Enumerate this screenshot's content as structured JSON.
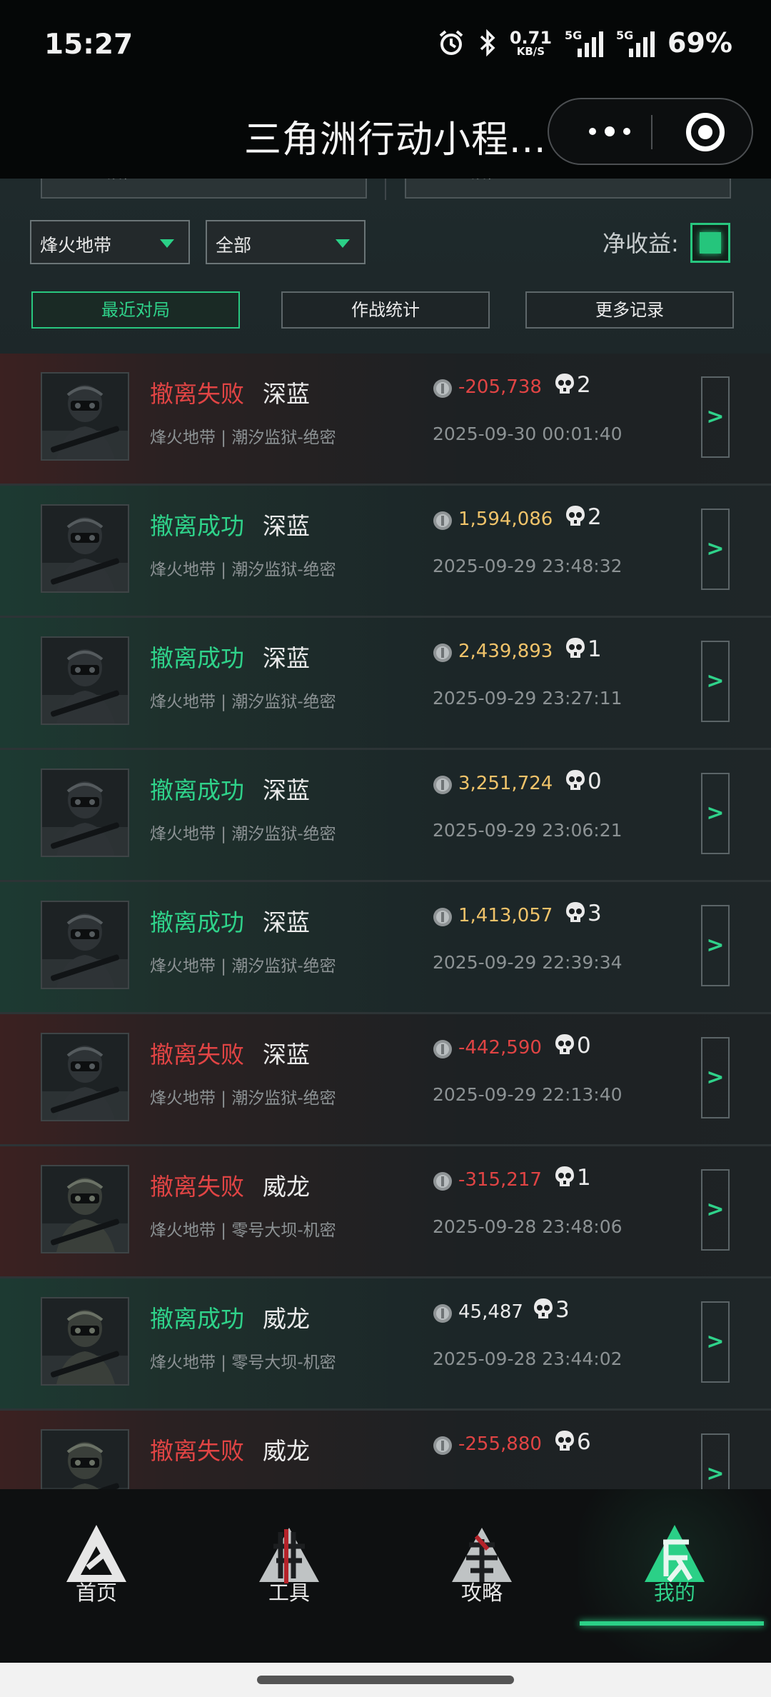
{
  "status_bar": {
    "time": "15:27",
    "net_speed_value": "0.71",
    "net_speed_unit": "KB/S",
    "network1": "5G",
    "network2": "5G",
    "battery": "69%"
  },
  "title_bar": {
    "title": "三角洲行动小程..."
  },
  "top_cards": {
    "left_label": "段位",
    "right_label": "段位"
  },
  "filters": {
    "mode": "烽火地带",
    "scope": "全部",
    "net_income_label": "净收益:"
  },
  "tabs": [
    {
      "label": "最近对局",
      "active": true
    },
    {
      "label": "作战统计",
      "active": false
    },
    {
      "label": "更多记录",
      "active": false
    }
  ],
  "matches": [
    {
      "result": "撤离失败",
      "status": "fail",
      "operator": "深蓝",
      "map": "烽火地带 | 潮汐监狱-绝密",
      "net": "-205,738",
      "sign": "neg",
      "kills": "2",
      "time": "2025-09-30 00:01:40",
      "avatar": "operator-a"
    },
    {
      "result": "撤离成功",
      "status": "success",
      "operator": "深蓝",
      "map": "烽火地带 | 潮汐监狱-绝密",
      "net": "1,594,086",
      "sign": "pos",
      "kills": "2",
      "time": "2025-09-29 23:48:32",
      "avatar": "operator-a"
    },
    {
      "result": "撤离成功",
      "status": "success",
      "operator": "深蓝",
      "map": "烽火地带 | 潮汐监狱-绝密",
      "net": "2,439,893",
      "sign": "pos",
      "kills": "1",
      "time": "2025-09-29 23:27:11",
      "avatar": "operator-a"
    },
    {
      "result": "撤离成功",
      "status": "success",
      "operator": "深蓝",
      "map": "烽火地带 | 潮汐监狱-绝密",
      "net": "3,251,724",
      "sign": "pos",
      "kills": "0",
      "time": "2025-09-29 23:06:21",
      "avatar": "operator-a"
    },
    {
      "result": "撤离成功",
      "status": "success",
      "operator": "深蓝",
      "map": "烽火地带 | 潮汐监狱-绝密",
      "net": "1,413,057",
      "sign": "pos",
      "kills": "3",
      "time": "2025-09-29 22:39:34",
      "avatar": "operator-a"
    },
    {
      "result": "撤离失败",
      "status": "fail",
      "operator": "深蓝",
      "map": "烽火地带 | 潮汐监狱-绝密",
      "net": "-442,590",
      "sign": "neg",
      "kills": "0",
      "time": "2025-09-29 22:13:40",
      "avatar": "operator-a"
    },
    {
      "result": "撤离失败",
      "status": "fail",
      "operator": "威龙",
      "map": "烽火地带 | 零号大坝-机密",
      "net": "-315,217",
      "sign": "neg",
      "kills": "1",
      "time": "2025-09-28 23:48:06",
      "avatar": "operator-b"
    },
    {
      "result": "撤离成功",
      "status": "success",
      "operator": "威龙",
      "map": "烽火地带 | 零号大坝-机密",
      "net": "45,487",
      "sign": "neutral",
      "kills": "3",
      "time": "2025-09-28 23:44:02",
      "avatar": "operator-b"
    },
    {
      "result": "撤离失败",
      "status": "fail",
      "operator": "威龙",
      "map": "",
      "net": "-255,880",
      "sign": "neg",
      "kills": "6",
      "time": "",
      "avatar": "operator-b"
    }
  ],
  "detail_glyph": ">",
  "bottom_nav": [
    {
      "label": "首页",
      "icon": "home-emblem-icon",
      "active": false
    },
    {
      "label": "工具",
      "icon": "tools-emblem-icon",
      "active": false
    },
    {
      "label": "攻略",
      "icon": "guide-emblem-icon",
      "active": false
    },
    {
      "label": "我的",
      "icon": "profile-emblem-icon",
      "active": true
    }
  ],
  "colors": {
    "accent_green": "#2fd28a",
    "fail_red": "#e04444",
    "gain_gold": "#f0c36a"
  }
}
